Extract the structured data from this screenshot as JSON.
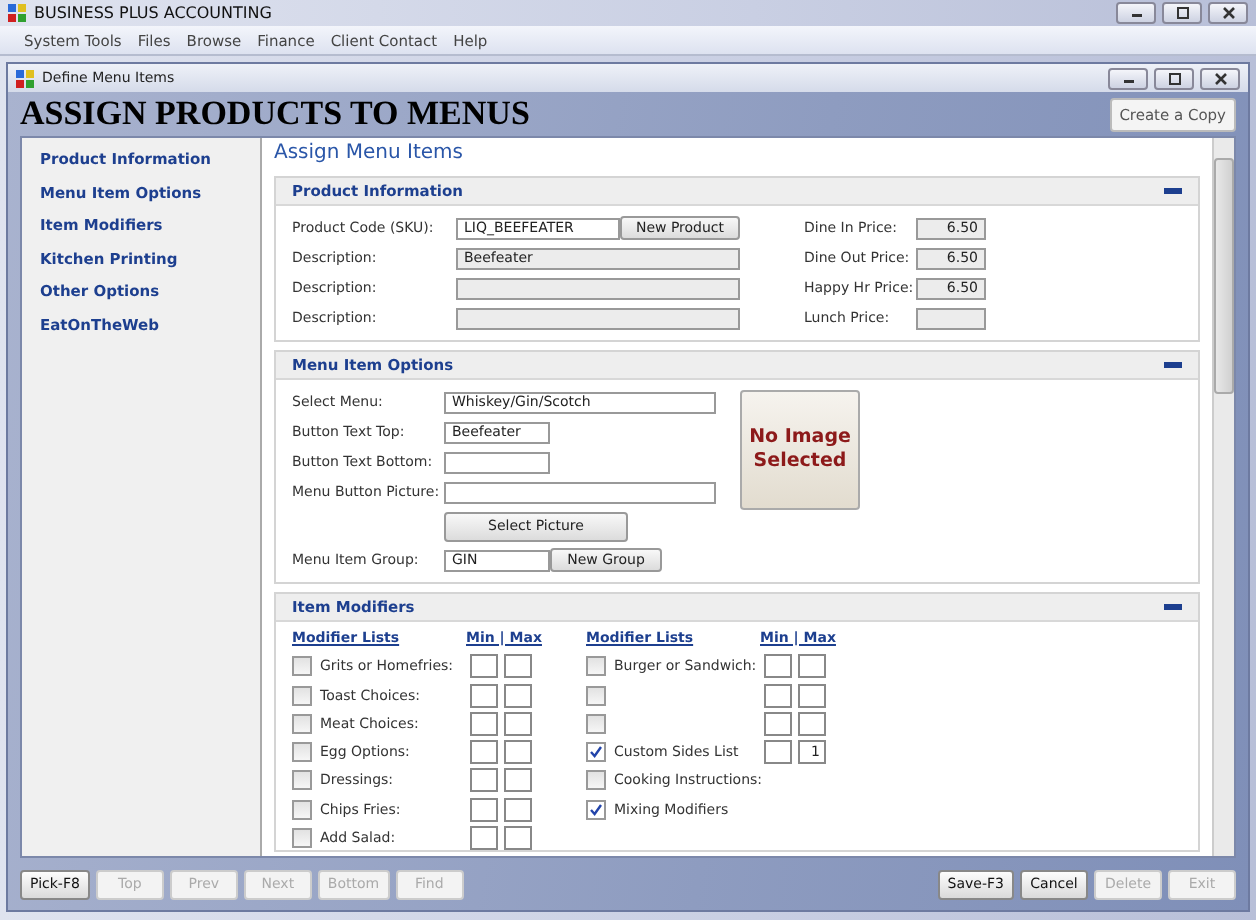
{
  "app_title": "BUSINESS PLUS ACCOUNTING",
  "menu": [
    "System Tools",
    "Files",
    "Browse",
    "Finance",
    "Client Contact",
    "Help"
  ],
  "child_window": {
    "title": "Define Menu Items"
  },
  "page_title": "ASSIGN PRODUCTS TO MENUS",
  "copy_button": "Create a Copy",
  "sidebar": [
    {
      "label": "Product Information"
    },
    {
      "label": "Menu Item Options"
    },
    {
      "label": "Item Modifiers"
    },
    {
      "label": "Kitchen Printing"
    },
    {
      "label": "Other Options"
    },
    {
      "label": "EatOnTheWeb"
    }
  ],
  "content_title": "Assign Menu Items",
  "product_information": {
    "title": "Product Information",
    "fields": [
      {
        "label": "Product Code (SKU):",
        "value": "LIQ_BEEFEATER",
        "readonly": false,
        "button": "New Product"
      },
      {
        "label": "Description:",
        "value": "Beefeater",
        "readonly": true
      },
      {
        "label": "Description:",
        "readonly": true
      },
      {
        "label": "Description:",
        "readonly": true
      }
    ],
    "prices": [
      {
        "label": "Dine In Price:",
        "value": "6.50"
      },
      {
        "label": "Dine Out Price:",
        "value": "6.50"
      },
      {
        "label": "Happy Hr Price:",
        "value": "6.50"
      },
      {
        "label": "Lunch Price:"
      }
    ]
  },
  "menu_item_options": {
    "title": "Menu Item Options",
    "fields": [
      {
        "label": "Select Menu:",
        "value": "Whiskey/Gin/Scotch",
        "kind": "long"
      },
      {
        "label": "Button Text Top:",
        "value": "Beefeater",
        "kind": "short"
      },
      {
        "label": "Button Text Bottom:",
        "kind": "short"
      },
      {
        "label": "Menu Button Picture:",
        "kind": "long"
      }
    ],
    "picture_button": "Select Picture",
    "group": {
      "label": "Menu Item Group:",
      "value": "GIN",
      "button": "New Group"
    },
    "image_placeholder": "No Image Selected"
  },
  "item_modifiers": {
    "title": "Item Modifiers",
    "columns": [
      {
        "heading": "Modifier Lists",
        "limits": "Min | Max",
        "rows": [
          {
            "label": "Grits or Homefries:",
            "checked": false,
            "limits": true
          },
          {
            "label": "Toast Choices:",
            "checked": false,
            "limits": true
          },
          {
            "label": "Meat Choices:",
            "checked": false,
            "limits": true
          },
          {
            "label": "Egg Options:",
            "checked": false,
            "limits": true
          },
          {
            "label": "Dressings:",
            "checked": false,
            "limits": true
          },
          {
            "label": "Chips Fries:",
            "checked": false,
            "limits": true
          },
          {
            "label": "Add Salad:",
            "checked": false,
            "limits": true
          }
        ]
      },
      {
        "heading": "Modifier Lists",
        "limits": "Min | Max",
        "rows": [
          {
            "label": "Burger or Sandwich:",
            "checked": false,
            "limits": true
          },
          {
            "checked": false,
            "limits": true
          },
          {
            "checked": false,
            "limits": true
          },
          {
            "label": "Custom Sides List",
            "checked": true,
            "limits": true,
            "max": "1"
          },
          {
            "label": "Cooking Instructions:",
            "checked": false,
            "limits": false
          },
          {
            "label": "Mixing Modifiers",
            "checked": true,
            "limits": false
          }
        ]
      }
    ]
  },
  "buttons_left": [
    {
      "label": "Pick-F8",
      "disabled": false
    },
    {
      "label": "Top",
      "disabled": true
    },
    {
      "label": "Prev",
      "disabled": true
    },
    {
      "label": "Next",
      "disabled": true
    },
    {
      "label": "Bottom",
      "disabled": true
    },
    {
      "label": "Find",
      "disabled": true
    }
  ],
  "buttons_right": [
    {
      "label": "Save-F3",
      "disabled": false
    },
    {
      "label": "Cancel",
      "disabled": false
    },
    {
      "label": "Delete",
      "disabled": true
    },
    {
      "label": "Exit",
      "disabled": true
    }
  ]
}
